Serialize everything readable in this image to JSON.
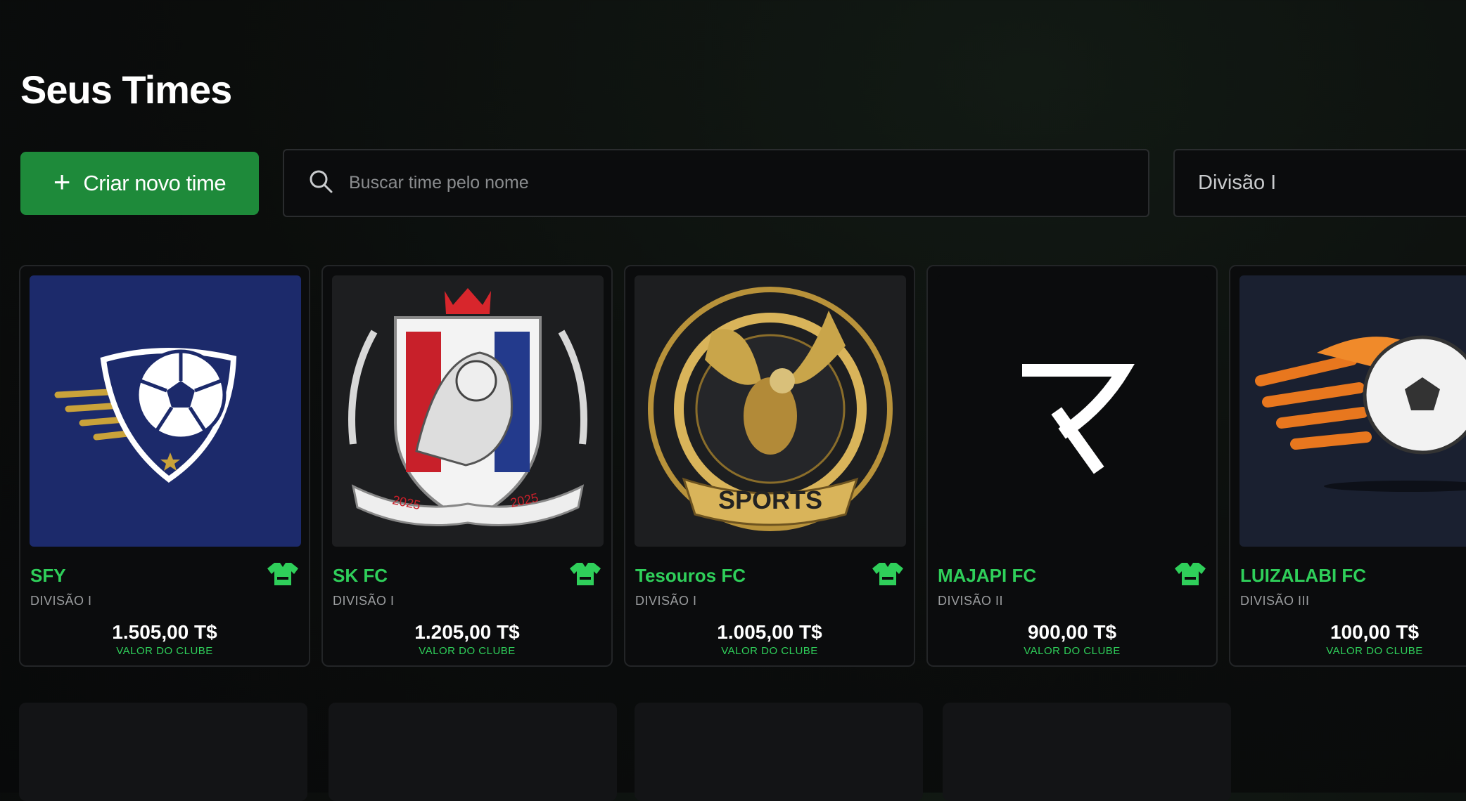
{
  "page": {
    "title": "Seus Times"
  },
  "toolbar": {
    "create_label": "Criar novo time",
    "search_placeholder": "Buscar time pelo nome",
    "division_selected": "Divisão I"
  },
  "colors": {
    "accent": "#2fcf5a",
    "button": "#1e8a3a"
  },
  "teams": [
    {
      "name": "SFY",
      "division": "DIVISÃO I",
      "value": "1.505,00 T$",
      "value_label": "VALOR DO CLUBE",
      "crest": "soccer-ball-shield-crest"
    },
    {
      "name": "SK FC",
      "division": "DIVISÃO I",
      "value": "1.205,00 T$",
      "value_label": "VALOR DO CLUBE",
      "crest": "lion-shield-crest",
      "crest_text": "2025"
    },
    {
      "name": "Tesouros FC",
      "division": "DIVISÃO I",
      "value": "1.005,00 T$",
      "value_label": "VALOR DO CLUBE",
      "crest": "eagle-crest",
      "crest_text": "SPORTS"
    },
    {
      "name": "MAJAPI FC",
      "division": "DIVISÃO II",
      "value": "900,00 T$",
      "value_label": "VALOR DO CLUBE",
      "crest": "katakana-ma-logo"
    },
    {
      "name": "LUIZALABI FC",
      "division": "DIVISÃO III",
      "value": "100,00 T$",
      "value_label": "VALOR DO CLUBE",
      "crest": "flaming-soccer-ball"
    }
  ]
}
